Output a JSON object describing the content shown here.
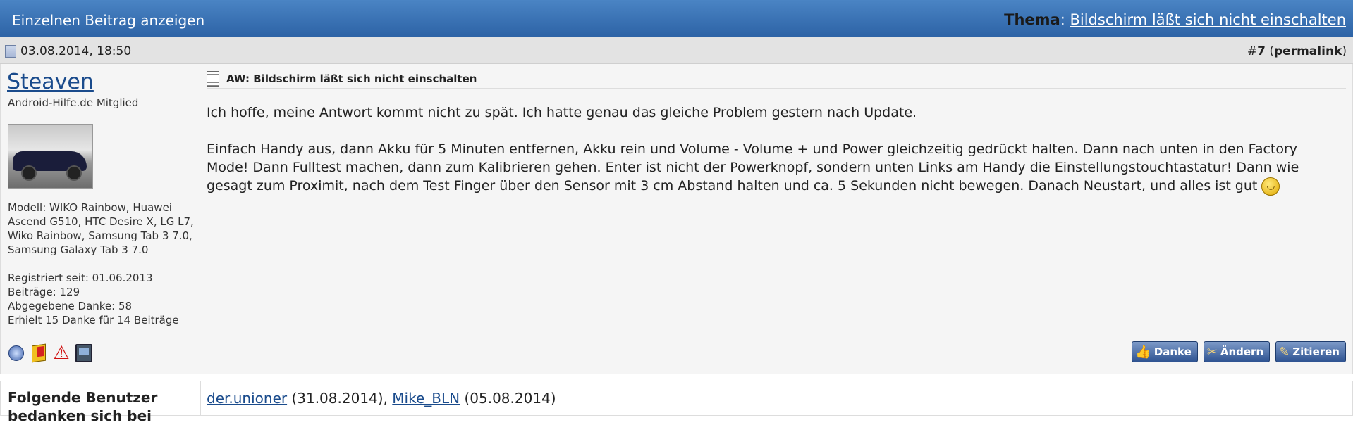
{
  "titlebar": {
    "left": "Einzelnen Beitrag anzeigen",
    "thema_label": "Thema",
    "thema_sep": ":",
    "thema_link": "Bildschirm läßt sich nicht einschalten"
  },
  "datebar": {
    "date": "03.08.2014, 18:50",
    "post_prefix": "#",
    "post_number": "7",
    "permalink_open": " (",
    "permalink": "permalink",
    "permalink_close": ")"
  },
  "user": {
    "name": "Steaven",
    "title": "Android-Hilfe.de Mitglied",
    "model": "Modell: WIKO Rainbow, Huawei Ascend G510, HTC Desire X, LG L7, Wiko Rainbow, Samsung Tab 3 7.0, Samsung Galaxy Tab 3 7.0",
    "registered": "Registriert seit: 01.06.2013",
    "posts": "Beiträge: 129",
    "given_thanks": "Abgegebene Danke: 58",
    "received_thanks": "Erhielt 15 Danke für 14 Beiträge"
  },
  "post": {
    "title": "AW: Bildschirm läßt sich nicht einschalten",
    "paragraph1": "Ich hoffe, meine Antwort kommt nicht zu spät. Ich hatte genau das gleiche Problem gestern nach Update.",
    "paragraph2": "Einfach Handy aus, dann Akku für 5 Minuten entfernen, Akku rein und Volume - Volume + und Power gleichzeitig gedrückt halten. Dann nach unten in den Factory Mode! Dann Fulltest machen, dann zum Kalibrieren gehen. Enter ist nicht der Powerknopf, sondern unten Links am Handy die Einstellungstouchtastatur! Dann wie gesagt zum Proximit, nach dem Test Finger über den Sensor mit 3 cm Abstand halten und ca. 5 Sekunden nicht bewegen. Danach Neustart, und alles ist gut"
  },
  "actions": {
    "thanks": "Danke",
    "edit": "Ändern",
    "quote": "Zitieren"
  },
  "thanks": {
    "label": "Folgende Benutzer bedanken sich bei",
    "user1": "der.unioner",
    "date1": " (31.08.2014), ",
    "user2": "Mike_BLN",
    "date2": " (05.08.2014)"
  }
}
